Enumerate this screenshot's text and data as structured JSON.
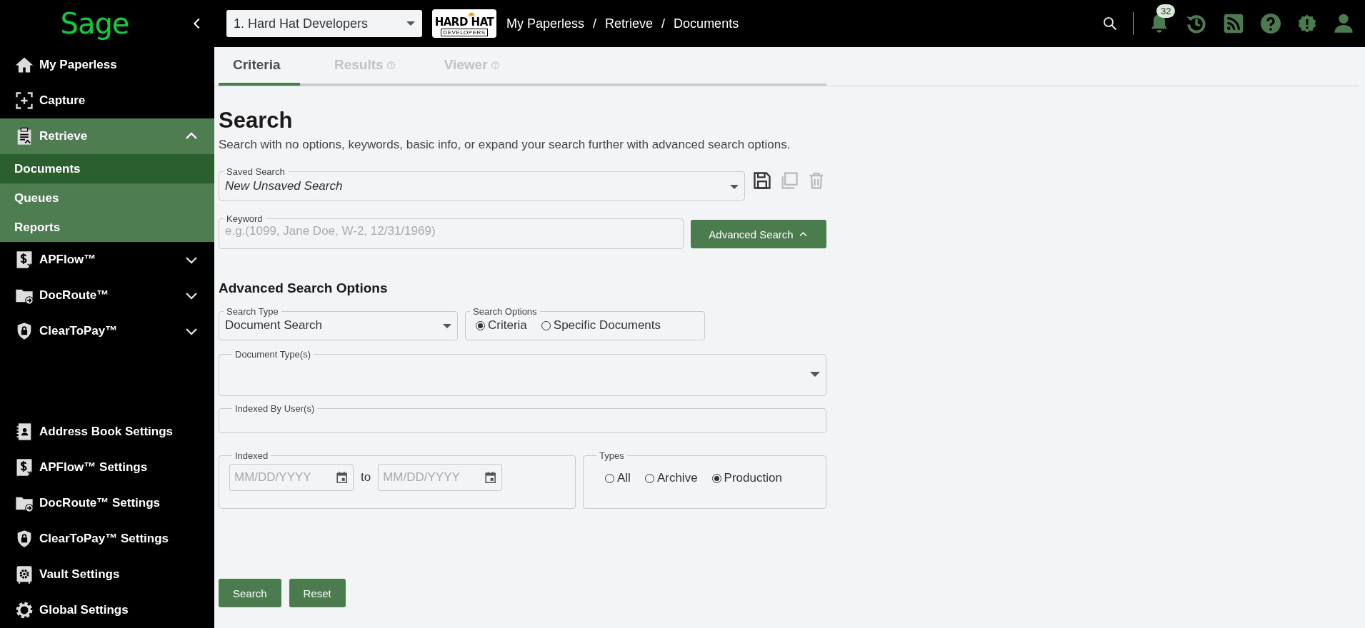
{
  "header": {
    "logo": "Sage",
    "company_select": {
      "value": "1. Hard Hat Developers"
    },
    "company_logo": {
      "title": "HARD HAT",
      "subtitle": "DEVELOPERS"
    },
    "breadcrumb": {
      "items": [
        "My Paperless",
        "Retrieve",
        "Documents"
      ],
      "separator": "/"
    },
    "notification_count": "32"
  },
  "sidebar": {
    "items": [
      {
        "label": "My Paperless",
        "kind": "link"
      },
      {
        "label": "Capture",
        "kind": "link"
      },
      {
        "label": "Retrieve",
        "kind": "group",
        "expanded": true,
        "children": [
          {
            "label": "Documents",
            "selected": true
          },
          {
            "label": "Queues",
            "selected": false
          },
          {
            "label": "Reports",
            "selected": false
          }
        ]
      },
      {
        "label": "APFlow™",
        "kind": "group",
        "expanded": false
      },
      {
        "label": "DocRoute™",
        "kind": "group",
        "expanded": false
      },
      {
        "label": "ClearToPay™",
        "kind": "group",
        "expanded": false
      }
    ],
    "settings": [
      {
        "label": "Address Book Settings"
      },
      {
        "label": "APFlow™ Settings"
      },
      {
        "label": "DocRoute™ Settings"
      },
      {
        "label": "ClearToPay™ Settings"
      },
      {
        "label": "Vault Settings"
      },
      {
        "label": "Global Settings"
      }
    ]
  },
  "tabs": [
    {
      "label": "Criteria",
      "selected": true,
      "help": false
    },
    {
      "label": "Results",
      "selected": false,
      "help": true
    },
    {
      "label": "Viewer",
      "selected": false,
      "help": true
    }
  ],
  "search": {
    "title": "Search",
    "description": "Search with no options, keywords, basic info, or expand your search further with advanced search options.",
    "saved_search": {
      "label": "Saved Search",
      "value": "New Unsaved Search"
    },
    "saved_search_actions": [
      {
        "kind": "save",
        "disabled": false
      },
      {
        "kind": "copy",
        "disabled": true
      },
      {
        "kind": "delete",
        "disabled": true
      }
    ],
    "keyword": {
      "label": "Keyword",
      "placeholder": "e.g.(1099, Jane Doe, W-2, 12/31/1969)"
    },
    "advanced_search_button": {
      "label": "Advanced Search",
      "expanded": true
    }
  },
  "advanced_options": {
    "title": "Advanced Search Options",
    "search_type": {
      "label": "Search Type",
      "value": "Document Search"
    },
    "search_options": {
      "label": "Search Options",
      "options": [
        {
          "label": "Criteria",
          "selected": true
        },
        {
          "label": "Specific Documents",
          "selected": false
        }
      ]
    },
    "document_types": {
      "label": "Document Type(s)"
    },
    "indexed_by_users": {
      "label": "Indexed By User(s)"
    },
    "indexed": {
      "label": "Indexed",
      "from": {
        "placeholder": "MM/DD/YYYY"
      },
      "separator": "to",
      "to": {
        "placeholder": "MM/DD/YYYY"
      }
    },
    "types": {
      "label": "Types",
      "options": [
        {
          "label": "All",
          "selected": false
        },
        {
          "label": "Archive",
          "selected": false
        },
        {
          "label": "Production",
          "selected": true
        }
      ]
    }
  },
  "buttons": [
    "Search",
    "Reset"
  ]
}
